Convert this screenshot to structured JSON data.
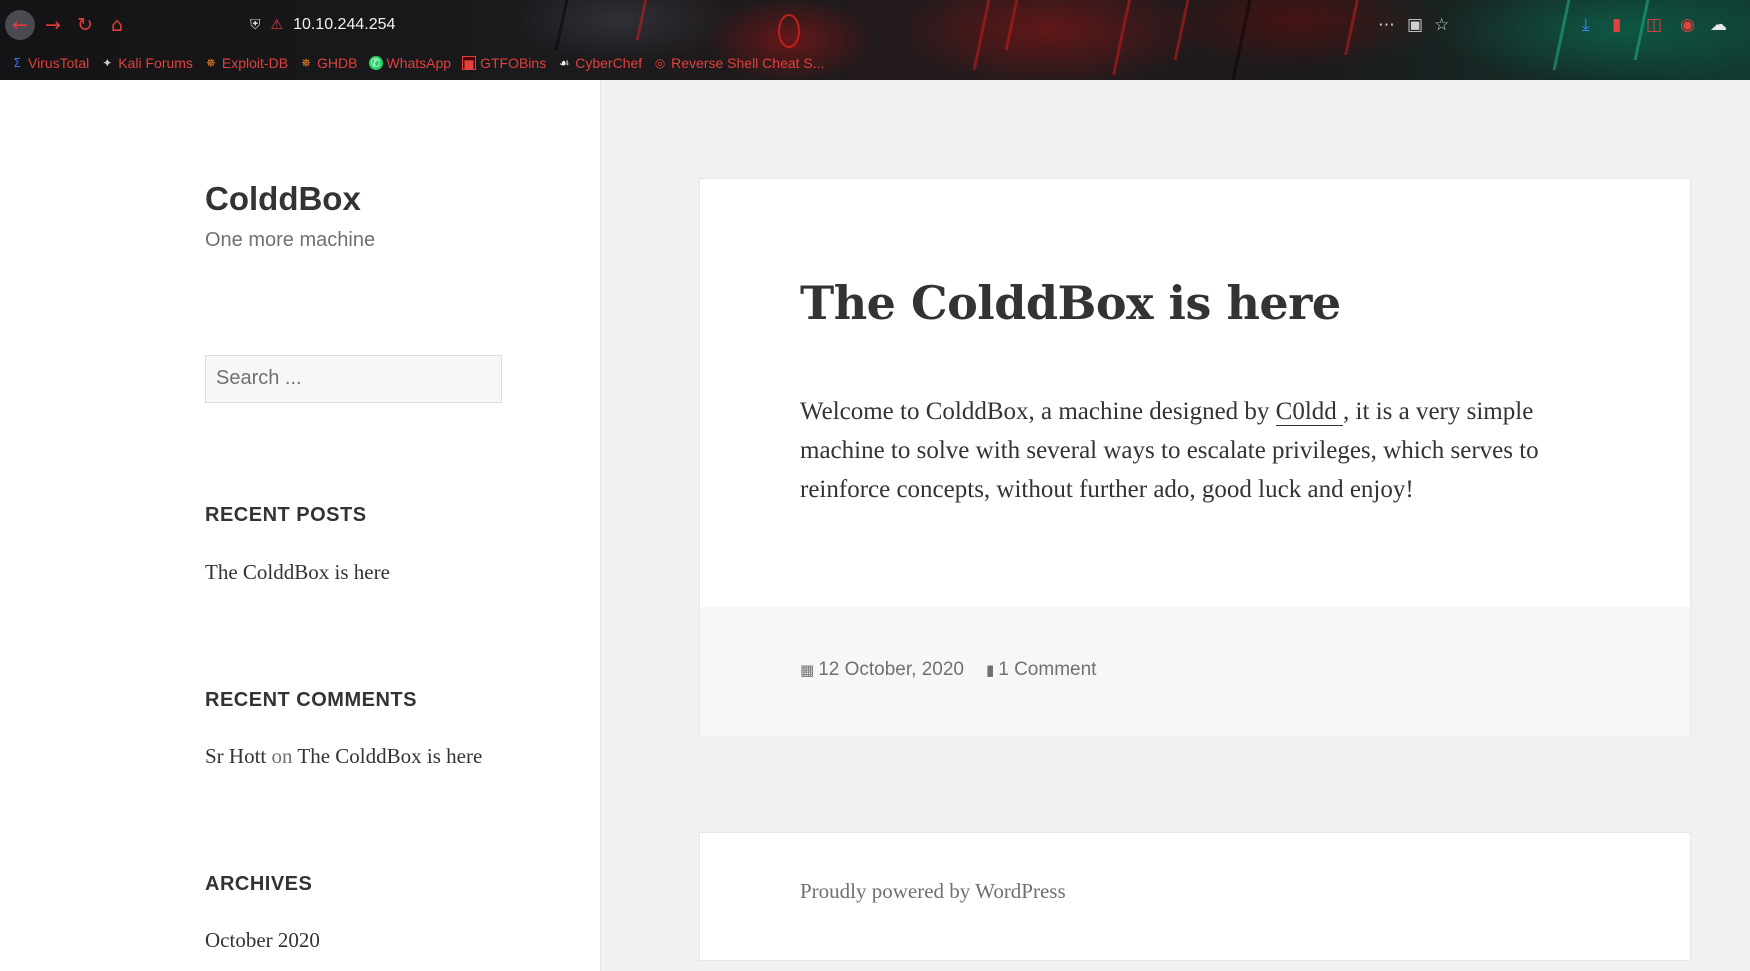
{
  "browser": {
    "url": "10.10.244.254",
    "bookmarks": [
      {
        "label": "VirusTotal",
        "icon": "sigma-icon"
      },
      {
        "label": "Kali Forums",
        "icon": "kali-dragon-icon"
      },
      {
        "label": "Exploit-DB",
        "icon": "exploit-db-icon"
      },
      {
        "label": "GHDB",
        "icon": "ghdb-icon"
      },
      {
        "label": "WhatsApp",
        "icon": "whatsapp-icon"
      },
      {
        "label": "GTFOBins",
        "icon": "gtfobins-icon"
      },
      {
        "label": "CyberChef",
        "icon": "chef-hat-icon"
      },
      {
        "label": "Reverse Shell Cheat S...",
        "icon": "globe-icon"
      }
    ]
  },
  "sidebar": {
    "site_title": "ColddBox",
    "site_description": "One more machine",
    "search_placeholder": "Search ...",
    "recent_posts_title": "RECENT POSTS",
    "recent_posts": [
      "The ColddBox is here"
    ],
    "recent_comments_title": "RECENT COMMENTS",
    "recent_comment": {
      "author": "Sr Hott",
      "on": "on",
      "post": "The ColddBox is here"
    },
    "archives_title": "ARCHIVES",
    "archives": [
      "October 2020"
    ]
  },
  "post": {
    "title": "The ColddBox is here",
    "content_before": "Welcome to ColddBox, a machine designed by ",
    "author_link": "C0ldd ",
    "content_after": ", it is a very simple machine to solve with several ways to escalate privileges, which serves to reinforce concepts, without further ado, good luck and enjoy!",
    "date": "12 October, 2020",
    "comments": "1 Comment"
  },
  "footer": {
    "text": "Proudly powered by WordPress"
  },
  "colors": {
    "accent": "#e2403c",
    "text": "#333333",
    "muted": "#707070"
  }
}
